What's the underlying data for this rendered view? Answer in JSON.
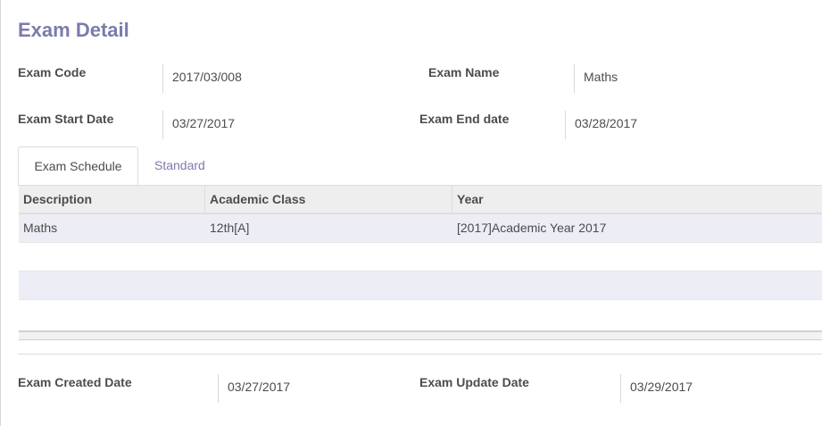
{
  "form": {
    "title": "Exam Detail",
    "fields": {
      "exam_code": {
        "label": "Exam Code",
        "value": "2017/03/008"
      },
      "exam_name": {
        "label": "Exam Name",
        "value": "Maths"
      },
      "exam_start_date": {
        "label": "Exam Start Date",
        "value": "03/27/2017"
      },
      "exam_end_date": {
        "label": "Exam End date",
        "value": "03/28/2017"
      },
      "exam_created_date": {
        "label": "Exam Created Date",
        "value": "03/27/2017"
      },
      "exam_update_date": {
        "label": "Exam Update Date",
        "value": "03/29/2017"
      }
    }
  },
  "tabs": [
    {
      "label": "Exam Schedule",
      "active": true
    },
    {
      "label": "Standard",
      "active": false
    }
  ],
  "schedule_table": {
    "columns": [
      "Description",
      "Academic Class",
      "Year"
    ],
    "rows": [
      [
        "Maths",
        "12th[A]",
        "[2017]Academic Year 2017"
      ]
    ]
  },
  "colors": {
    "accent": "#7c7bad",
    "row_alt": "#ededf6",
    "header_bg": "#eeeeee"
  }
}
